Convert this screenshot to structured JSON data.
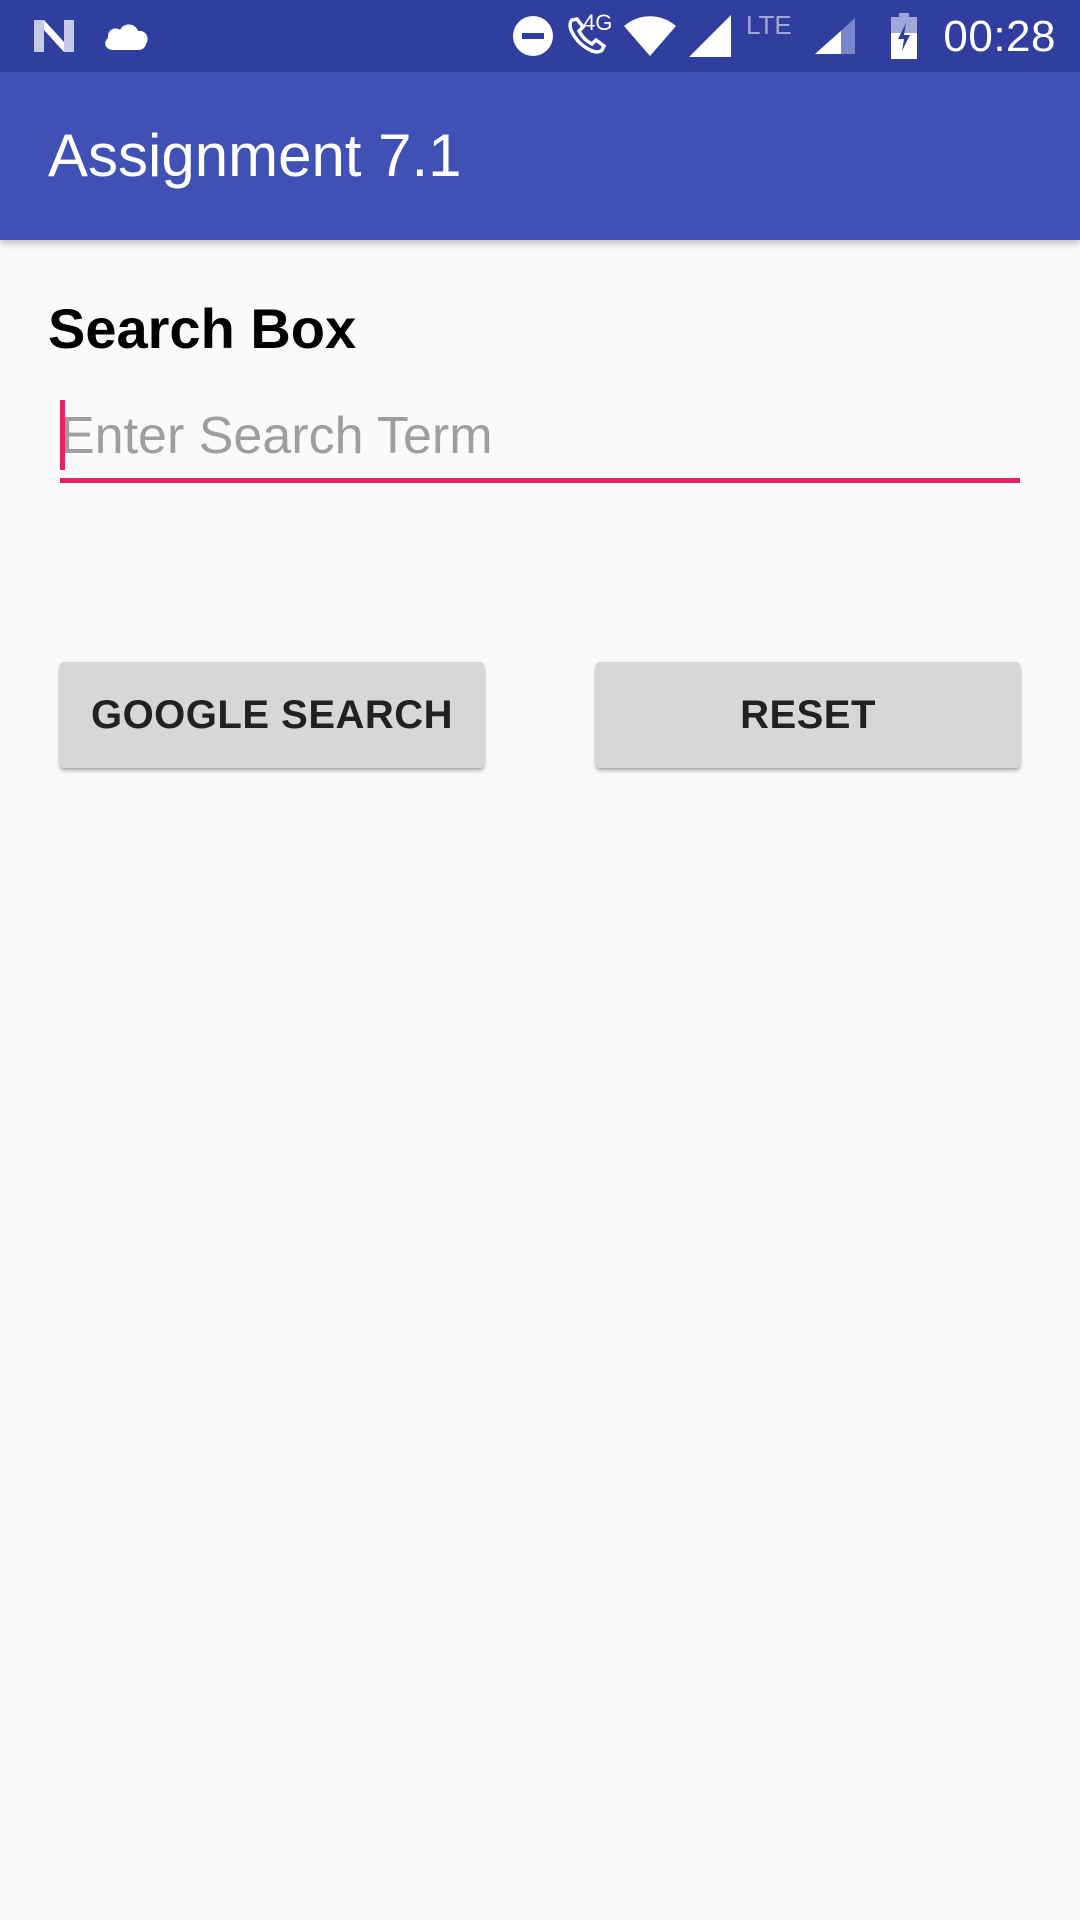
{
  "status_bar": {
    "time": "00:28",
    "network_label_4g": "4G",
    "network_label_lte": "LTE",
    "icons": [
      "n-logo-icon",
      "cloud-icon",
      "do-not-disturb-icon",
      "wifi-call-icon",
      "wifi-icon",
      "signal-icon",
      "signal-icon",
      "battery-charging-icon"
    ]
  },
  "app_bar": {
    "title": "Assignment 7.1"
  },
  "search": {
    "label": "Search Box",
    "placeholder": "Enter Search Term",
    "value": ""
  },
  "buttons": {
    "google_search": "GOOGLE SEARCH",
    "reset": "RESET"
  },
  "colors": {
    "status_bar": "#303f9f",
    "app_bar": "#3f51b5",
    "accent": "#e91e63",
    "button_bg": "#d6d7d7",
    "background": "#fafafa"
  }
}
